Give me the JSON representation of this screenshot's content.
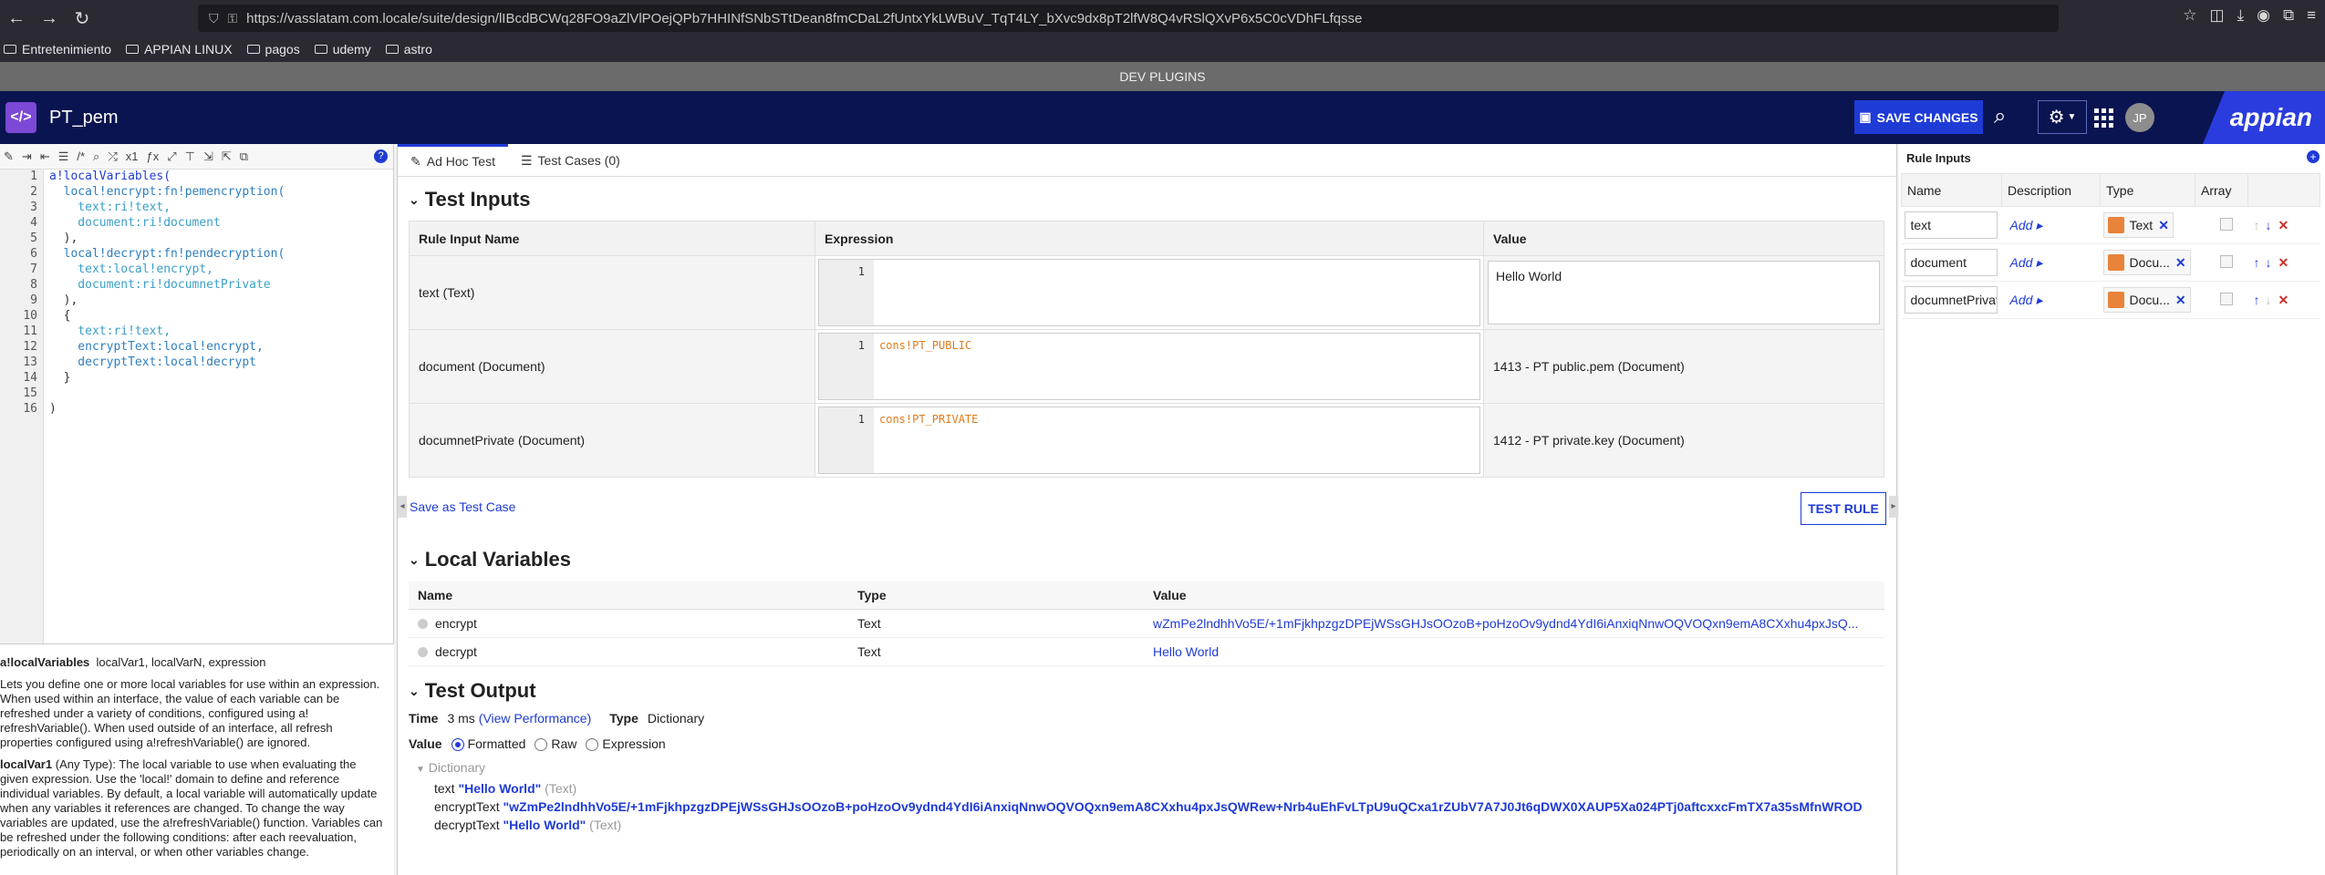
{
  "browser": {
    "url": "https://vasslatam.com.locale/suite/design/lIBcdBCWq28FO9aZlVlPOejQPb7HHINfSNbSTtDean8fmCDaL2fUntxYkLWBuV_TqT4LY_bXvc9dx8pT2lfW8Q4vRSlQXvP6x5C0cVDhFLfqsse",
    "bookmarks": [
      "Entretenimiento",
      "APPIAN LINUX",
      "pagos",
      "udemy",
      "astro"
    ],
    "dev_plugins_label": "DEV PLUGINS"
  },
  "header": {
    "rule_name": "PT_pem",
    "save_label": "SAVE CHANGES",
    "avatar_initials": "JP",
    "logo_text": "appian"
  },
  "editor": {
    "line_numbers": [
      "1",
      "2",
      "3",
      "4",
      "5",
      "6",
      "7",
      "8",
      "9",
      "10",
      "11",
      "12",
      "13",
      "14",
      "15",
      "16"
    ],
    "lines": [
      "a!localVariables(",
      "  local!encrypt:fn!pemencryption(",
      "    text:ri!text,",
      "    document:ri!document",
      "  ),",
      "  local!decrypt:fn!pendecryption(",
      "    text:local!encrypt,",
      "    document:ri!documnetPrivate",
      "  ),",
      "  {",
      "    text:ri!text,",
      "    encryptText:local!encrypt,",
      "    decryptText:local!decrypt",
      "  }",
      "",
      ")"
    ]
  },
  "docs": {
    "signature_name": "a!localVariables",
    "signature_params": "localVar1, localVarN, expression",
    "description": "Lets you define one or more local variables for use within an expression. When used within an interface, the value of each variable can be refreshed under a variety of conditions, configured using a! refreshVariable(). When used outside of an interface, all refresh properties configured using a!refreshVariable() are ignored.",
    "param_name": "localVar1",
    "param_desc": "(Any Type): The local variable to use when evaluating the given expression. Use the 'local!' domain to define and reference individual variables. By default, a local variable will automatically update when any variables it references are changed. To change the way variables are updated, use the a!refreshVariable() function. Variables can be refreshed under the following conditions: after each reevaluation, periodically on an interval, or when other variables change."
  },
  "tabs": [
    {
      "label": "Ad Hoc Test"
    },
    {
      "label": "Test Cases (0)"
    }
  ],
  "test_inputs": {
    "title": "Test Inputs",
    "columns": [
      "Rule Input Name",
      "Expression",
      "Value"
    ],
    "rows": [
      {
        "name": "text (Text)",
        "line": "1",
        "expr": "",
        "value": "Hello World"
      },
      {
        "name": "document (Document)",
        "line": "1",
        "expr": "cons!PT_PUBLIC",
        "value": "1413 - PT public.pem (Document)"
      },
      {
        "name": "documnetPrivate (Document)",
        "line": "1",
        "expr": "cons!PT_PRIVATE",
        "value": "1412 - PT private.key (Document)"
      }
    ],
    "save_test_case": "Save as Test Case",
    "test_rule": "TEST RULE"
  },
  "local_variables": {
    "title": "Local Variables",
    "columns": [
      "Name",
      "Type",
      "Value"
    ],
    "rows": [
      {
        "name": "encrypt",
        "type": "Text",
        "value": "wZmPe2lndhhVo5E/+1mFjkhpzgzDPEjWSsGHJsOOzoB+poHzoOv9ydnd4YdI6iAnxiqNnwOQVOQxn9emA8CXxhu4pxJsQ..."
      },
      {
        "name": "decrypt",
        "type": "Text",
        "value": "Hello World"
      }
    ]
  },
  "test_output": {
    "title": "Test Output",
    "time_label": "Time",
    "time_value": "3 ms",
    "view_performance": "(View Performance)",
    "type_label": "Type",
    "type_value": "Dictionary",
    "value_label": "Value",
    "formats": [
      "Formatted",
      "Raw",
      "Expression"
    ],
    "dict_label": "Dictionary",
    "entries": [
      {
        "key": "text",
        "value": "\"Hello World\"",
        "type": "(Text)"
      },
      {
        "key": "encryptText",
        "value": "\"wZmPe2lndhhVo5E/+1mFjkhpzgzDPEjWSsGHJsOOzoB+poHzoOv9ydnd4YdI6iAnxiqNnwOQVOQxn9emA8CXxhu4pxJsQWRew+Nrb4uEhFvLTpU9uQCxa1rZUbV7A7J0Jt6qDWX0XAUP5Xa024PTj0aftcxxcFmTX7a35sMfnWROD",
        "type": ""
      },
      {
        "key": "decryptText",
        "value": "\"Hello World\"",
        "type": "(Text)"
      }
    ]
  },
  "rule_inputs": {
    "title": "Rule Inputs",
    "columns": [
      "Name",
      "Description",
      "Type",
      "Array"
    ],
    "add_label": "Add",
    "rows": [
      {
        "name": "text",
        "type": "Text"
      },
      {
        "name": "document",
        "type": "Docu..."
      },
      {
        "name": "documnetPrivate",
        "type": "Docu..."
      }
    ]
  }
}
